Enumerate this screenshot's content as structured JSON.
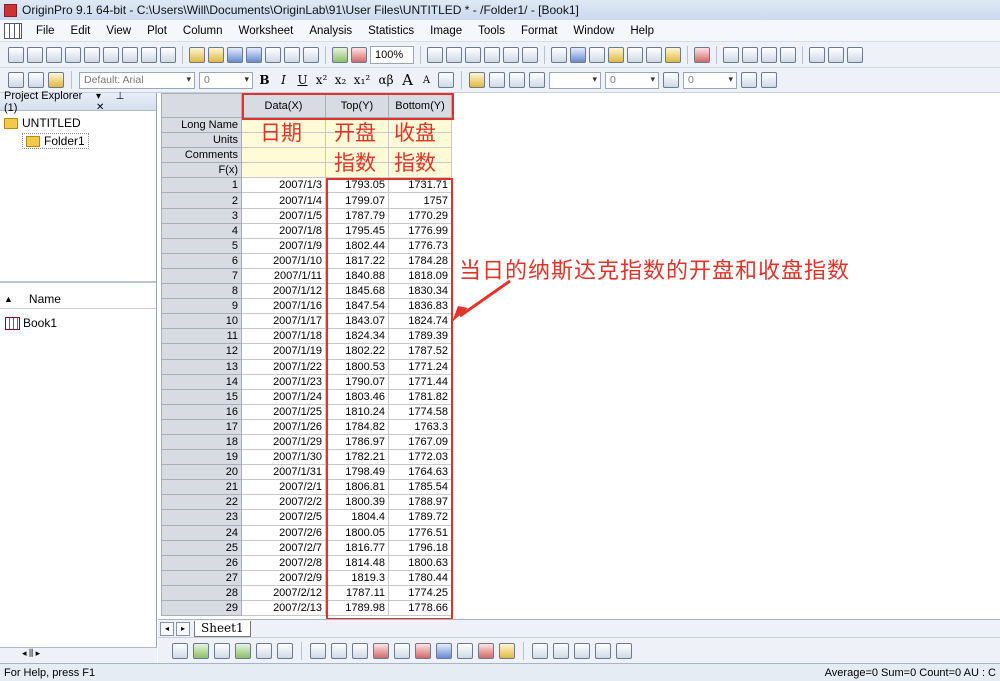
{
  "window": {
    "title": "OriginPro 9.1 64-bit - C:\\Users\\Will\\Documents\\OriginLab\\91\\User Files\\UNTITLED * - /Folder1/ - [Book1]"
  },
  "menu": [
    "File",
    "Edit",
    "View",
    "Plot",
    "Column",
    "Worksheet",
    "Analysis",
    "Statistics",
    "Image",
    "Tools",
    "Format",
    "Window",
    "Help"
  ],
  "toolbar": {
    "zoom": "100%",
    "font": "Default: Arial",
    "font_size": "0",
    "line_width": "0",
    "bold": "B",
    "italic": "I",
    "underline": "U",
    "superscript": "x²",
    "subscript": "x₂",
    "subsuper": "x₁²",
    "greek": "αβ",
    "bigger": "A",
    "smaller": "A"
  },
  "explorer": {
    "title": "Project Explorer (1)",
    "root": "UNTITLED",
    "folder": "Folder1",
    "name_header": "Name",
    "items": [
      "Book1"
    ]
  },
  "worksheet": {
    "columns": [
      "Data(X)",
      "Top(Y)",
      "Bottom(Y)"
    ],
    "label_rows": [
      "Long Name",
      "Units",
      "Comments",
      "F(x)"
    ],
    "long_names_cjk": [
      "日期",
      "开盘",
      "收盘"
    ],
    "units_cjk": [
      "",
      "指数",
      "指数"
    ],
    "rows": [
      [
        "2007/1/3",
        "1793.05",
        "1731.71"
      ],
      [
        "2007/1/4",
        "1799.07",
        "1757"
      ],
      [
        "2007/1/5",
        "1787.79",
        "1770.29"
      ],
      [
        "2007/1/8",
        "1795.45",
        "1776.99"
      ],
      [
        "2007/1/9",
        "1802.44",
        "1776.73"
      ],
      [
        "2007/1/10",
        "1817.22",
        "1784.28"
      ],
      [
        "2007/1/11",
        "1840.88",
        "1818.09"
      ],
      [
        "2007/1/12",
        "1845.68",
        "1830.34"
      ],
      [
        "2007/1/16",
        "1847.54",
        "1836.83"
      ],
      [
        "2007/1/17",
        "1843.07",
        "1824.74"
      ],
      [
        "2007/1/18",
        "1824.34",
        "1789.39"
      ],
      [
        "2007/1/19",
        "1802.22",
        "1787.52"
      ],
      [
        "2007/1/22",
        "1800.53",
        "1771.24"
      ],
      [
        "2007/1/23",
        "1790.07",
        "1771.44"
      ],
      [
        "2007/1/24",
        "1803.46",
        "1781.82"
      ],
      [
        "2007/1/25",
        "1810.24",
        "1774.58"
      ],
      [
        "2007/1/26",
        "1784.82",
        "1763.3"
      ],
      [
        "2007/1/29",
        "1786.97",
        "1767.09"
      ],
      [
        "2007/1/30",
        "1782.21",
        "1772.03"
      ],
      [
        "2007/1/31",
        "1798.49",
        "1764.63"
      ],
      [
        "2007/2/1",
        "1806.81",
        "1785.54"
      ],
      [
        "2007/2/2",
        "1800.39",
        "1788.97"
      ],
      [
        "2007/2/5",
        "1804.4",
        "1789.72"
      ],
      [
        "2007/2/6",
        "1800.05",
        "1776.51"
      ],
      [
        "2007/2/7",
        "1816.77",
        "1796.18"
      ],
      [
        "2007/2/8",
        "1814.48",
        "1800.63"
      ],
      [
        "2007/2/9",
        "1819.3",
        "1780.44"
      ],
      [
        "2007/2/12",
        "1787.11",
        "1774.25"
      ],
      [
        "2007/2/13",
        "1789.98",
        "1778.66"
      ]
    ],
    "sheet_tab": "Sheet1"
  },
  "annotation": "当日的纳斯达克指数的开盘和收盘指数",
  "status": {
    "left": "For Help, press F1",
    "right": "Average=0 Sum=0 Count=0  AU : C"
  },
  "colors": {
    "annotation": "#e0342a",
    "label_bg": "#fffbd6",
    "header_bg": "#d8dce2"
  }
}
